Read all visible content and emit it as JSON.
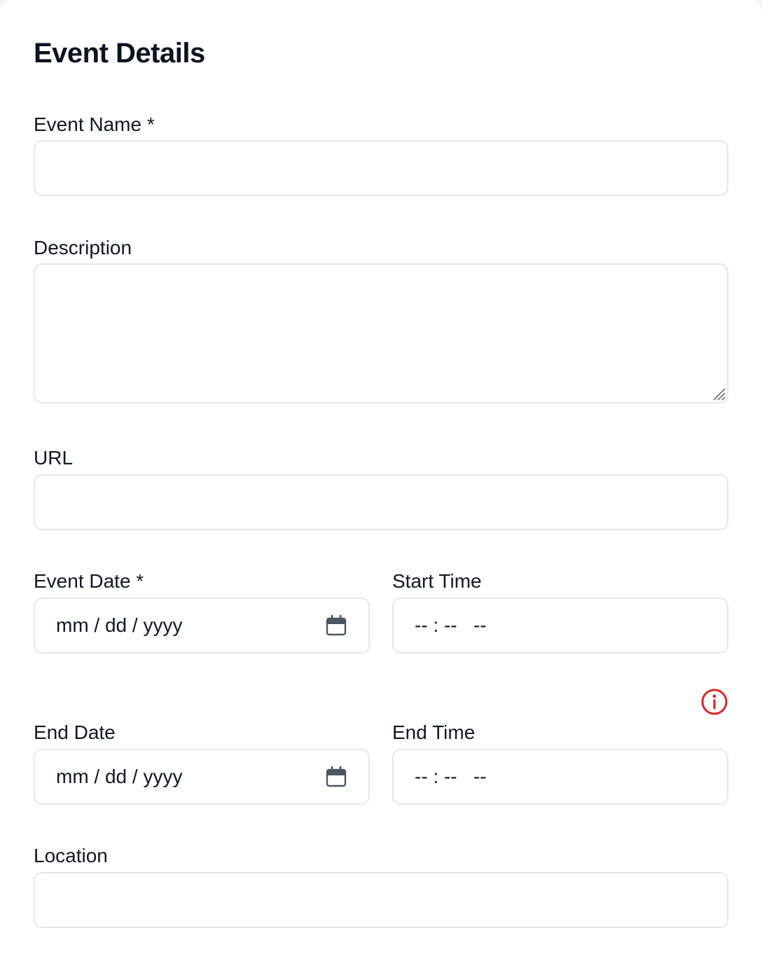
{
  "form": {
    "title": "Event Details",
    "event_name": {
      "label": "Event Name *",
      "value": ""
    },
    "description": {
      "label": "Description",
      "value": ""
    },
    "url": {
      "label": "URL",
      "value": ""
    },
    "event_date": {
      "label": "Event Date *",
      "placeholder": "mm / dd / yyyy",
      "icon": "calendar-icon"
    },
    "start_time": {
      "label": "Start Time",
      "placeholder": "-- : --   --"
    },
    "end_date": {
      "label": "End Date",
      "placeholder": "mm / dd / yyyy",
      "icon": "calendar-icon"
    },
    "end_time": {
      "label": "End Time",
      "placeholder": "-- : --   --"
    },
    "location": {
      "label": "Location",
      "value": ""
    },
    "validation_icon": {
      "icon": "info-icon",
      "color": "#dc2626"
    }
  },
  "colors": {
    "border": "#e5e7eb",
    "text": "#111827",
    "error": "#dc2626"
  }
}
